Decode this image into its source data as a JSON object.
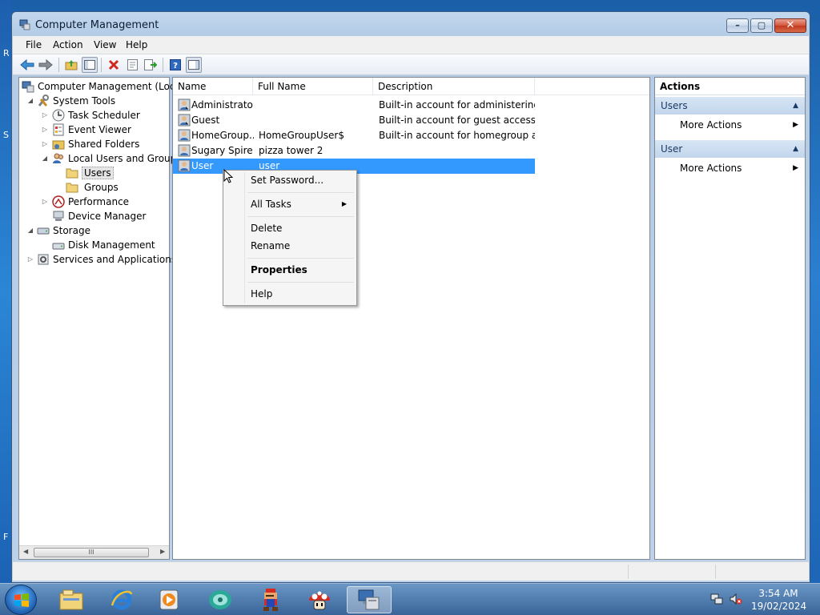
{
  "desktop": {
    "edge_chars": [
      "R",
      "S",
      "F"
    ]
  },
  "window": {
    "title": "Computer Management",
    "buttons": {
      "minimize": "–",
      "maximize": "▢",
      "close": "✕"
    }
  },
  "menubar": {
    "items": [
      "File",
      "Action",
      "View",
      "Help"
    ]
  },
  "toolbar": {
    "buttons": [
      "back-icon",
      "forward-icon",
      "up-folder-icon",
      "show-hide-tree-icon",
      "delete-icon",
      "properties-icon",
      "export-icon",
      "help-icon",
      "action-pane-icon"
    ]
  },
  "tree": {
    "items": [
      {
        "label": "Computer Management (Local",
        "icon": "computer-management-icon",
        "expander": ""
      },
      {
        "label": "System Tools",
        "icon": "system-tools-icon",
        "expander": "◢"
      },
      {
        "label": "Task Scheduler",
        "icon": "task-scheduler-icon",
        "expander": "▷"
      },
      {
        "label": "Event Viewer",
        "icon": "event-viewer-icon",
        "expander": "▷"
      },
      {
        "label": "Shared Folders",
        "icon": "shared-folders-icon",
        "expander": "▷"
      },
      {
        "label": "Local Users and Groups",
        "icon": "local-users-groups-icon",
        "expander": "◢"
      },
      {
        "label": "Users",
        "icon": "folder-icon",
        "expander": "",
        "selected": true
      },
      {
        "label": "Groups",
        "icon": "folder-icon",
        "expander": ""
      },
      {
        "label": "Performance",
        "icon": "performance-icon",
        "expander": "▷"
      },
      {
        "label": "Device Manager",
        "icon": "device-manager-icon",
        "expander": ""
      },
      {
        "label": "Storage",
        "icon": "storage-icon",
        "expander": "◢"
      },
      {
        "label": "Disk Management",
        "icon": "disk-management-icon",
        "expander": ""
      },
      {
        "label": "Services and Applications",
        "icon": "services-apps-icon",
        "expander": "▷"
      }
    ],
    "scrollbar": {
      "left_arrow": "◀",
      "right_arrow": "▶",
      "thumb_grip": "III"
    }
  },
  "list": {
    "columns": [
      "Name",
      "Full Name",
      "Description"
    ],
    "rows": [
      {
        "name": "Administrator",
        "full_name": "",
        "description": "Built-in account for administering..."
      },
      {
        "name": "Guest",
        "full_name": "",
        "description": "Built-in account for guest access t..."
      },
      {
        "name": "HomeGroup...",
        "full_name": "HomeGroupUser$",
        "description": "Built-in account for homegroup a..."
      },
      {
        "name": "Sugary Spire",
        "full_name": "pizza tower 2",
        "description": ""
      },
      {
        "name": "User",
        "full_name": "user",
        "description": "",
        "selected": true
      }
    ]
  },
  "context_menu": {
    "items": [
      {
        "label": "Set Password...",
        "submenu": false
      },
      {
        "label": "All Tasks",
        "submenu": true
      },
      {
        "label": "Delete",
        "submenu": false
      },
      {
        "label": "Rename",
        "submenu": false
      },
      {
        "label": "Properties",
        "submenu": false,
        "bold": true
      },
      {
        "label": "Help",
        "submenu": false
      }
    ],
    "submenu_arrow": "▶"
  },
  "actions_pane": {
    "title": "Actions",
    "groups": [
      {
        "header": "Users",
        "collapse_glyph": "▲",
        "items": [
          {
            "label": "More Actions",
            "arrow": "▶"
          }
        ]
      },
      {
        "header": "User",
        "collapse_glyph": "▲",
        "items": [
          {
            "label": "More Actions",
            "arrow": "▶"
          }
        ]
      }
    ]
  },
  "taskbar": {
    "pinned": [
      "explorer-icon",
      "internet-explorer-icon",
      "media-player-icon",
      "app-icon",
      "mario-icon",
      "mushroom-icon",
      "computer-management-taskbar-icon"
    ],
    "clock": {
      "time": "3:54 AM",
      "date": "19/02/2024"
    }
  },
  "colors": {
    "selection": "#3399ff",
    "title_bar": "#b3cbe6",
    "taskbar": "#3c6496",
    "action_group_header": "#c1d5ec"
  }
}
